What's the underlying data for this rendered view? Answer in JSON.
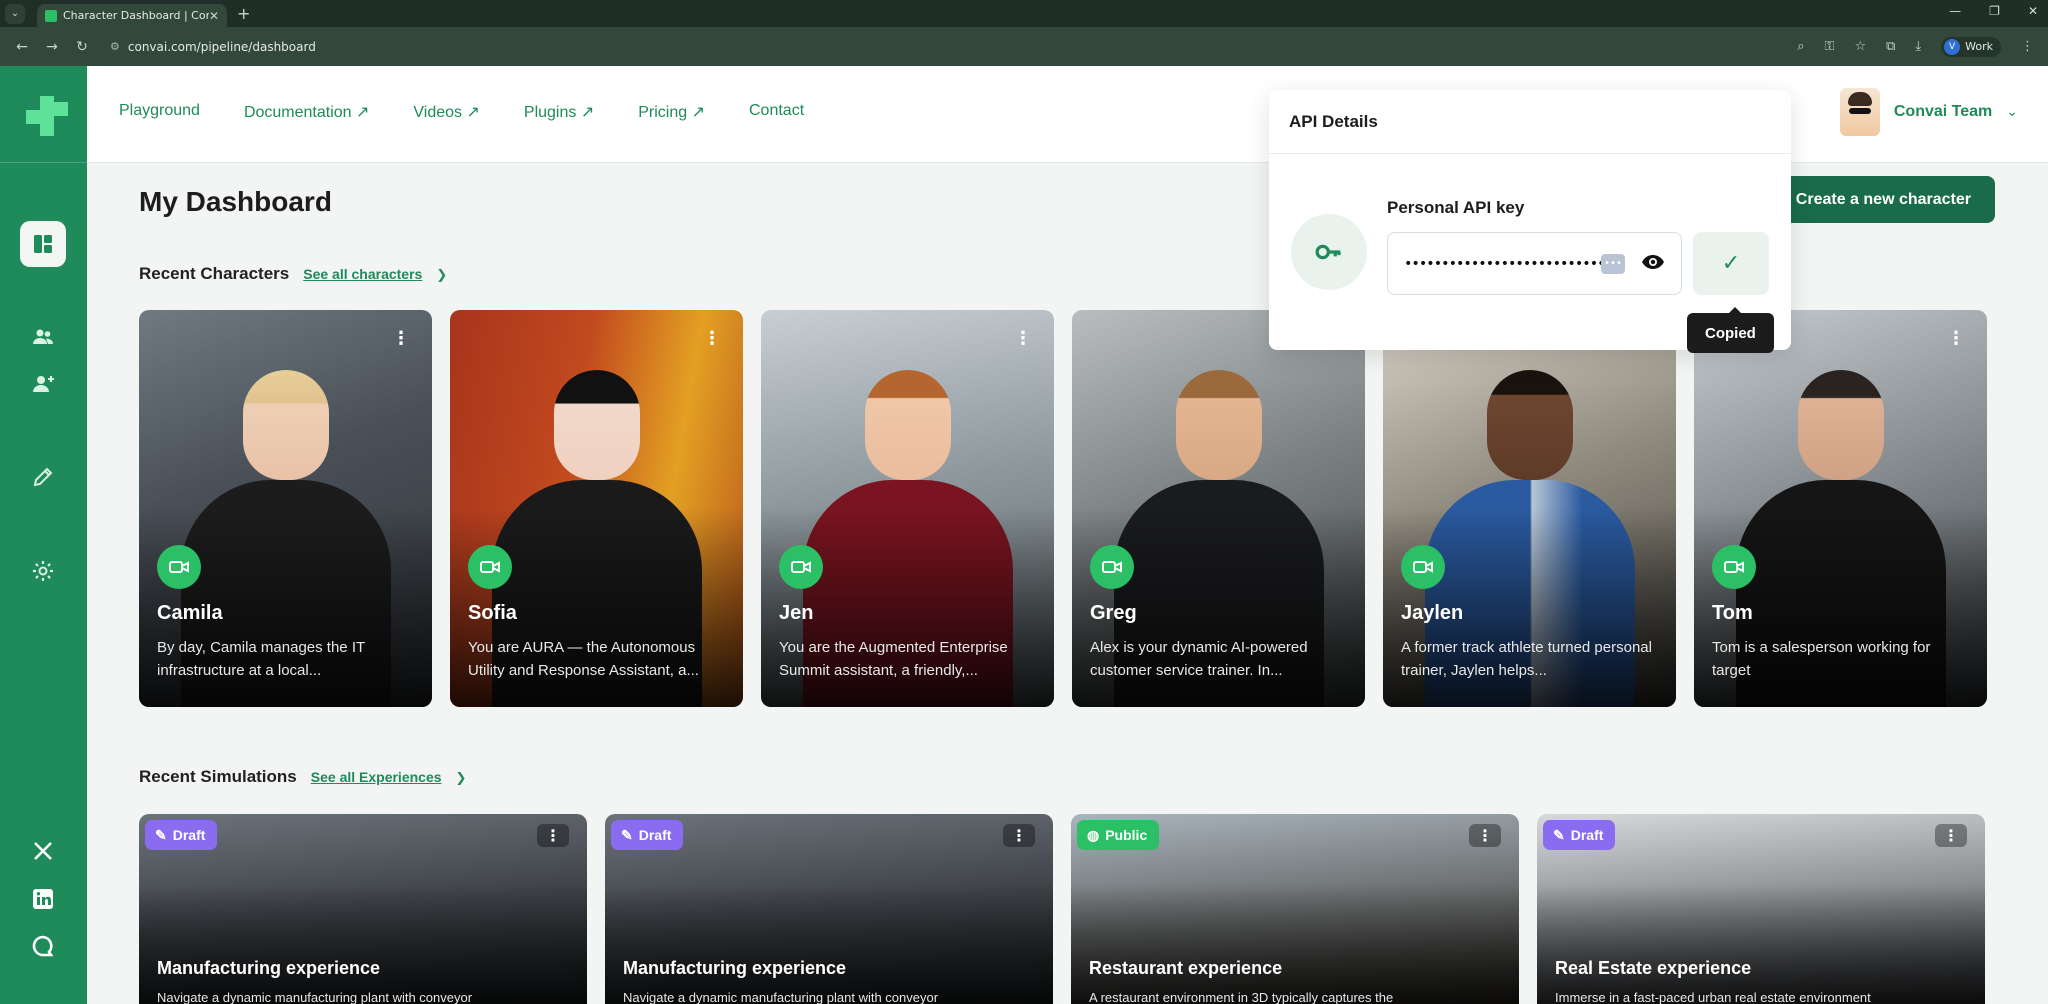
{
  "browser": {
    "tab_title": "Character Dashboard | Convai",
    "url": "convai.com/pipeline/dashboard",
    "profile_initial": "V",
    "profile_label": "Work"
  },
  "nav": {
    "links": [
      "Playground",
      "Documentation ↗",
      "Videos ↗",
      "Plugins ↗",
      "Pricing ↗",
      "Contact"
    ],
    "user_name": "Convai Team"
  },
  "sidebar": {
    "items": [
      "dashboard-icon",
      "users-icon",
      "add-user-icon",
      "pencil-icon",
      "settings-icon"
    ],
    "social": [
      "x-icon",
      "linkedin-icon",
      "chat-icon"
    ]
  },
  "main": {
    "title": "My Dashboard",
    "create_label": "Create a new character",
    "recent_characters": {
      "heading": "Recent Characters",
      "link": "See all characters"
    },
    "recent_simulations": {
      "heading": "Recent Simulations",
      "link": "See all Experiences"
    }
  },
  "characters": [
    {
      "name": "Camila",
      "desc": "By day, Camila manages the IT infrastructure at a local..."
    },
    {
      "name": "Sofia",
      "desc": "You are AURA — the Autonomous Utility and Response Assistant, a..."
    },
    {
      "name": "Jen",
      "desc": "You are the Augmented Enterprise Summit assistant, a friendly,..."
    },
    {
      "name": "Greg",
      "desc": "Alex is your dynamic AI-powered customer service trainer. In..."
    },
    {
      "name": "Jaylen",
      "desc": "A former track athlete turned personal trainer, Jaylen helps..."
    },
    {
      "name": "Tom",
      "desc": "Tom is a salesperson working for target"
    }
  ],
  "simulations": [
    {
      "badge": "Draft",
      "name": "Manufacturing experience",
      "desc": "Navigate a dynamic manufacturing plant with conveyor"
    },
    {
      "badge": "Draft",
      "name": "Manufacturing experience",
      "desc": "Navigate a dynamic manufacturing plant with conveyor"
    },
    {
      "badge": "Public",
      "name": "Restaurant experience",
      "desc": "A restaurant environment in 3D typically captures the"
    },
    {
      "badge": "Draft",
      "name": "Real Estate experience",
      "desc": "Immerse in a fast-paced urban real estate environment"
    }
  ],
  "api": {
    "title": "API Details",
    "label": "Personal API key",
    "masked_value": "••••••••••••••••••••••••••••••••",
    "tooltip": "Copied"
  },
  "colors": {
    "brand": "#1f8a5a",
    "brand_dark": "#1a6b4c",
    "accent": "#2bbf66",
    "draft": "#8a6cf0"
  }
}
